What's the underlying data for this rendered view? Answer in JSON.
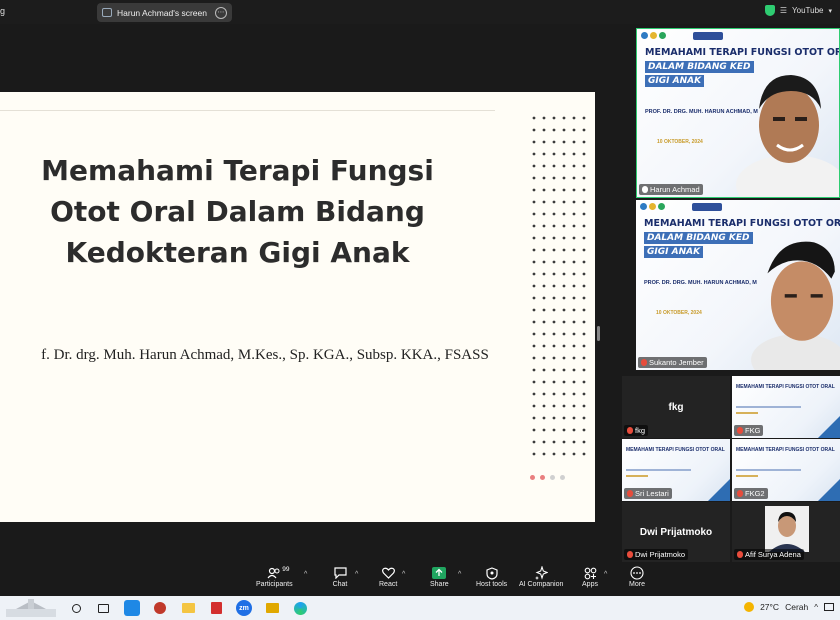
{
  "topbar": {
    "left_fragment": "g",
    "share_pill": "Harun Achmad's screen",
    "more_glyph": "⋯",
    "right_status": "YouTube",
    "colors": {
      "shield": "#2ecc71"
    }
  },
  "slide": {
    "title_lines": [
      "Memahami Terapi Fungsi",
      "Otot Oral Dalam Bidang",
      "Kedokteran Gigi Anak"
    ],
    "author": "f. Dr. drg. Muh. Harun Achmad, M.Kes., Sp. KGA., Subsp. KKA., FSASS",
    "page_dots": 4,
    "active_dot": 1
  },
  "gallery": {
    "mini_slide": {
      "title": "MEMAHAMI TERAPI FUNGSI OTOT ORAL",
      "subtitle_1": "DALAM BIDANG KED",
      "subtitle_2": "GIGI ANAK",
      "presenter": "PROF. DR. DRG. MUH. HARUN ACHMAD, M",
      "date": "10 OKTOBER, 2024"
    },
    "tiles": [
      {
        "name": "Harun Achmad"
      },
      {
        "name": "Sukanto Jember"
      },
      {
        "name": "fkg",
        "card": "fkg"
      },
      {
        "name": "FKG"
      },
      {
        "name": "Sri Lestari"
      },
      {
        "name": "FKG2"
      },
      {
        "name": "Dwi Prijatmoko",
        "card": "Dwi Prijatmoko"
      },
      {
        "name": "Afif Surya Adena"
      }
    ],
    "small_slide_text": "MEMAHAMI TERAPI FUNGSI OTOT ORAL\nDALAM BIDANG KEDOKTERAN\nGIGI ANAK"
  },
  "toolbar": {
    "participants_count": "99",
    "items": [
      {
        "label": "Participants",
        "icon": "participants-icon"
      },
      {
        "label": "Chat",
        "icon": "chat-icon"
      },
      {
        "label": "React",
        "icon": "heart-icon"
      },
      {
        "label": "Share",
        "icon": "share-icon"
      },
      {
        "label": "Host tools",
        "icon": "shield-icon"
      },
      {
        "label": "AI Companion",
        "icon": "sparkle-icon"
      },
      {
        "label": "Apps",
        "icon": "apps-icon"
      },
      {
        "label": "More",
        "icon": "more-icon"
      }
    ],
    "colors": {
      "share": "#20a560"
    }
  },
  "taskbar": {
    "temperature": "27°C",
    "weather": "Cerah",
    "zoom_label": "zm"
  }
}
